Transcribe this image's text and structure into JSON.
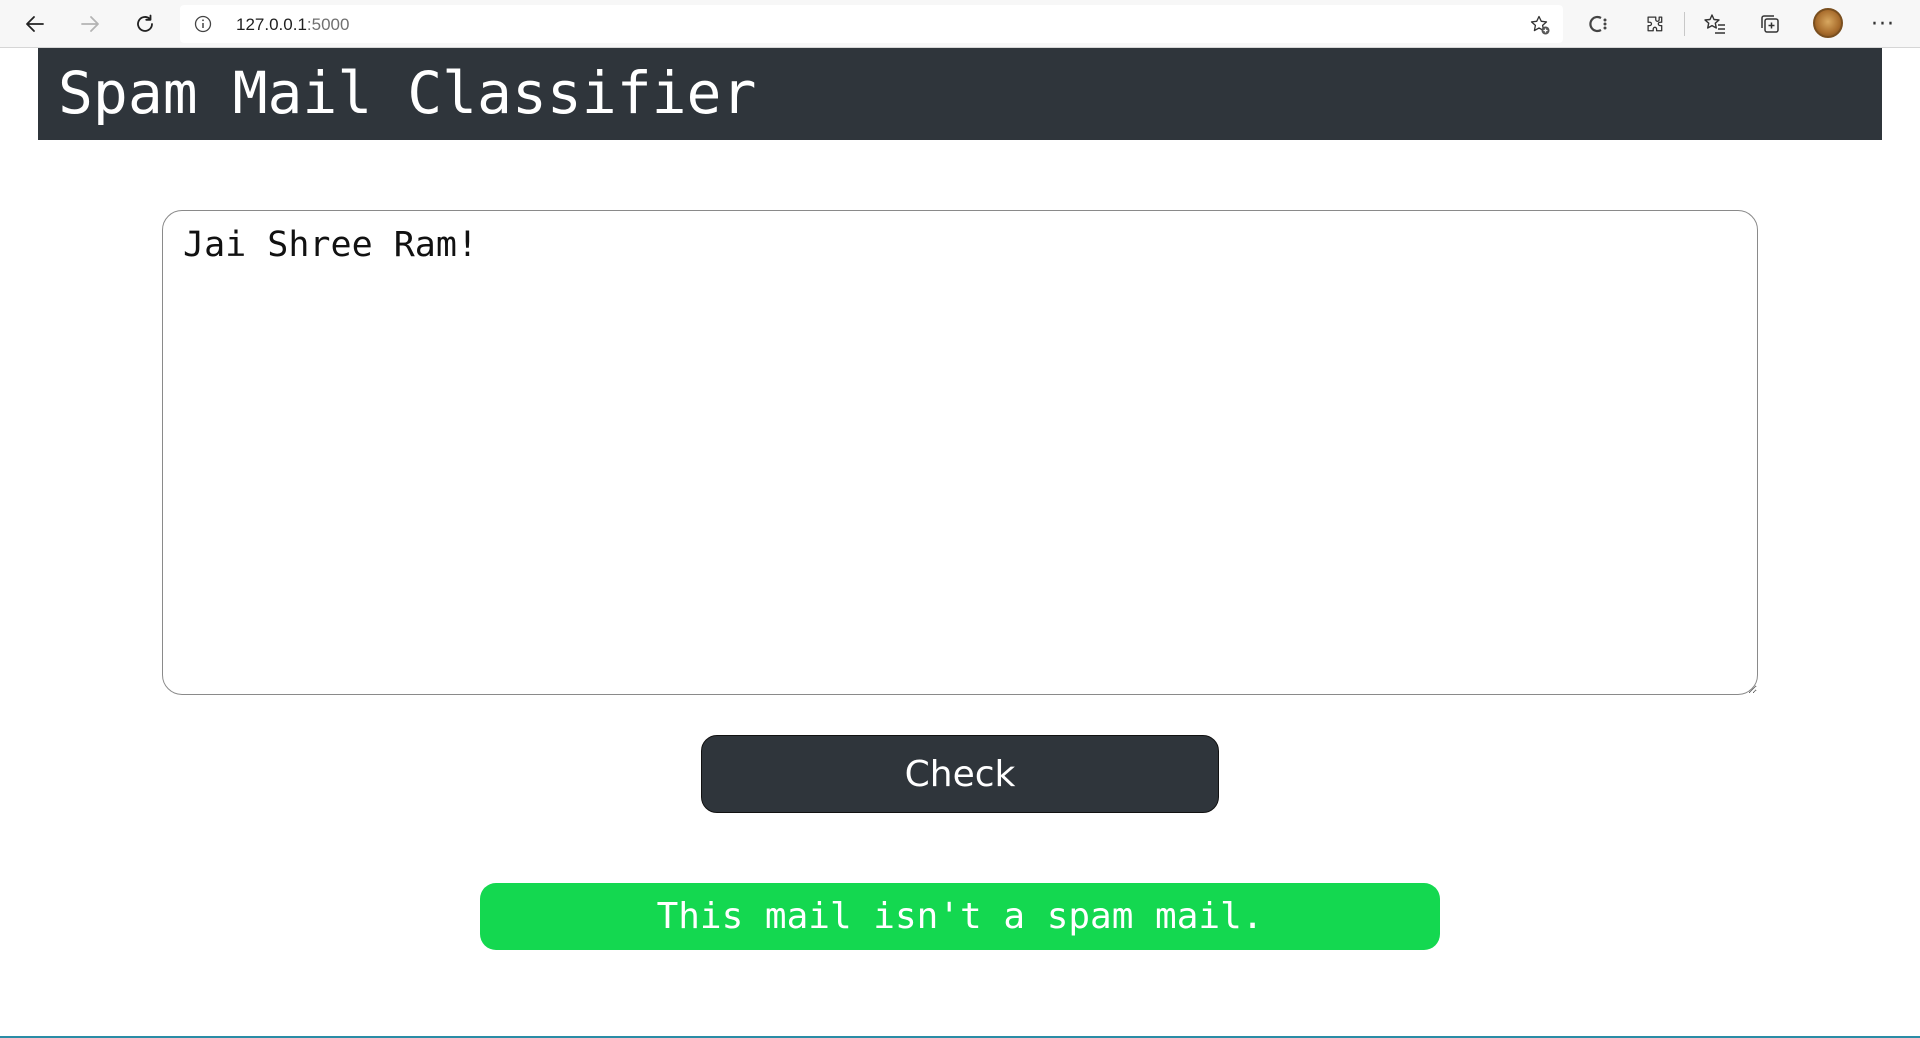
{
  "browser": {
    "url_host": "127.0.0.1",
    "url_port": ":5000",
    "icons": {
      "back": "back-arrow-icon",
      "forward": "forward-arrow-icon",
      "refresh": "refresh-icon",
      "info": "info-icon",
      "favorite": "add-favorite-icon",
      "copilot": "copilot-icon",
      "extensions": "extensions-icon",
      "favorites": "favorites-icon",
      "collections": "collections-icon",
      "profile": "profile-avatar",
      "more": "more-icon"
    },
    "more_label": "···"
  },
  "header": {
    "title": "Spam Mail Classifier",
    "background": "#2f353b"
  },
  "form": {
    "mail_text": "Jai Shree Ram!",
    "check_label": "Check"
  },
  "result": {
    "message": "This mail isn't a spam mail.",
    "color": "#14d850"
  }
}
